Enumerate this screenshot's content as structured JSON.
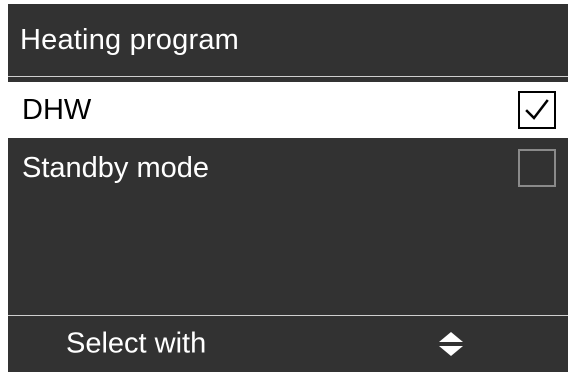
{
  "header": {
    "title": "Heating program"
  },
  "list": {
    "items": [
      {
        "label": "DHW",
        "checked": true,
        "selected": true
      },
      {
        "label": "Standby mode",
        "checked": false,
        "selected": false
      }
    ]
  },
  "footer": {
    "label": "Select with",
    "icon": "up-down-arrows-icon"
  },
  "colors": {
    "screen_background": "#323232",
    "text": "#ffffff",
    "selected_row_background": "#ffffff",
    "selected_row_text": "#000000"
  }
}
